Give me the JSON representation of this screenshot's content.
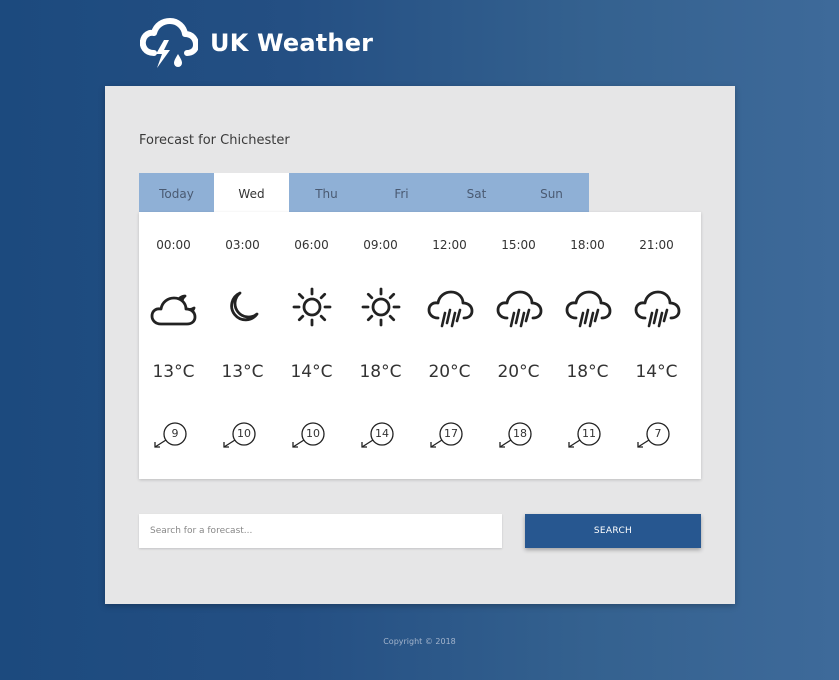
{
  "brand": {
    "title": "UK Weather",
    "icon": "storm-cloud-icon"
  },
  "forecast": {
    "heading": "Forecast for Chichester",
    "tabs": [
      {
        "label": "Today",
        "active": false
      },
      {
        "label": "Wed",
        "active": true
      },
      {
        "label": "Thu",
        "active": false
      },
      {
        "label": "Fri",
        "active": false
      },
      {
        "label": "Sat",
        "active": false
      },
      {
        "label": "Sun",
        "active": false
      }
    ],
    "hours": [
      {
        "time": "00:00",
        "icon": "partly-cloudy-night-icon",
        "temp": "13°C",
        "wind": "9"
      },
      {
        "time": "03:00",
        "icon": "moon-icon",
        "temp": "13°C",
        "wind": "10"
      },
      {
        "time": "06:00",
        "icon": "sun-icon",
        "temp": "14°C",
        "wind": "10"
      },
      {
        "time": "09:00",
        "icon": "sun-icon",
        "temp": "18°C",
        "wind": "14"
      },
      {
        "time": "12:00",
        "icon": "rain-cloud-icon",
        "temp": "20°C",
        "wind": "17"
      },
      {
        "time": "15:00",
        "icon": "rain-cloud-icon",
        "temp": "20°C",
        "wind": "18"
      },
      {
        "time": "18:00",
        "icon": "rain-cloud-icon",
        "temp": "18°C",
        "wind": "11"
      },
      {
        "time": "21:00",
        "icon": "rain-cloud-icon",
        "temp": "14°C",
        "wind": "7"
      }
    ]
  },
  "search": {
    "placeholder": "Search for a forecast...",
    "value": "",
    "button_label": "SEARCH"
  },
  "footer": {
    "copyright": "Copyright © 2018"
  },
  "colors": {
    "background_gradient_start": "#1c4a7e",
    "background_gradient_end": "#3e6a9a",
    "panel": "#e6e6e7",
    "tab_bar": "#8fb0d6",
    "button": "#275790"
  }
}
